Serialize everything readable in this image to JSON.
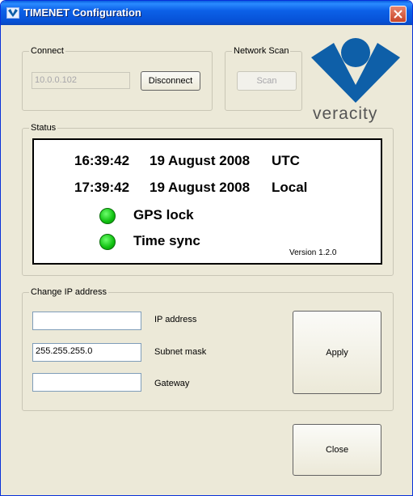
{
  "window": {
    "title": "TIMENET Configuration",
    "title_color": "#0a5fe0"
  },
  "icons": {
    "app": "veracity-app-icon",
    "close": "close-icon",
    "logo": "veracity-logo"
  },
  "connect": {
    "legend": "Connect",
    "ip_value": "10.0.0.102",
    "disconnect_label": "Disconnect"
  },
  "network_scan": {
    "legend": "Network Scan",
    "scan_label": "Scan"
  },
  "logo": {
    "text": "veracity",
    "color": "#0e5fa8"
  },
  "status": {
    "legend": "Status",
    "utc_time": "16:39:42",
    "utc_date": "19 August 2008",
    "utc_zone": "UTC",
    "local_time": "17:39:42",
    "local_date": "19 August 2008",
    "local_zone": "Local",
    "gps_lock_label": "GPS lock",
    "time_sync_label": "Time sync",
    "indicator_color": "#10c010",
    "version": "Version 1.2.0"
  },
  "change_ip": {
    "legend": "Change IP address",
    "ip_value": "",
    "ip_label": "IP address",
    "subnet_value": "255.255.255.0",
    "subnet_label": "Subnet mask",
    "gateway_value": "",
    "gateway_label": "Gateway",
    "apply_label": "Apply"
  },
  "footer": {
    "close_label": "Close"
  }
}
